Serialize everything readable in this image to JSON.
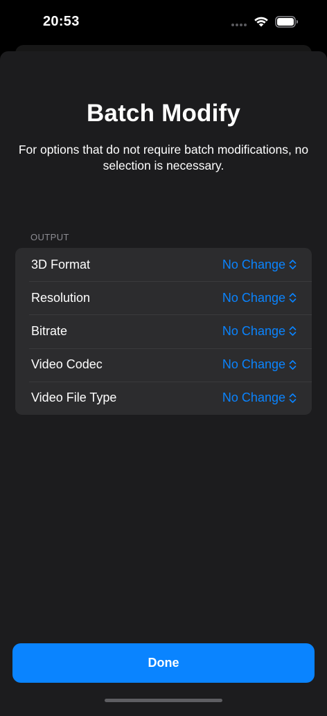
{
  "status_bar": {
    "time": "20:53",
    "icons": [
      "cellular-dots-icon",
      "wifi-icon",
      "battery-icon"
    ]
  },
  "sheet": {
    "title": "Batch Modify",
    "subtitle": "For options that do not require batch modifications, no selection is necessary.",
    "section": {
      "header": "OUTPUT",
      "rows": [
        {
          "label": "3D Format",
          "value": "No Change"
        },
        {
          "label": "Resolution",
          "value": "No Change"
        },
        {
          "label": "Bitrate",
          "value": "No Change"
        },
        {
          "label": "Video Codec",
          "value": "No Change"
        },
        {
          "label": "Video File Type",
          "value": "No Change"
        }
      ]
    },
    "done_label": "Done"
  },
  "colors": {
    "background": "#1c1c1e",
    "group_background": "#2c2c2e",
    "accent": "#0a84ff",
    "secondary_text": "#8d8d93"
  }
}
